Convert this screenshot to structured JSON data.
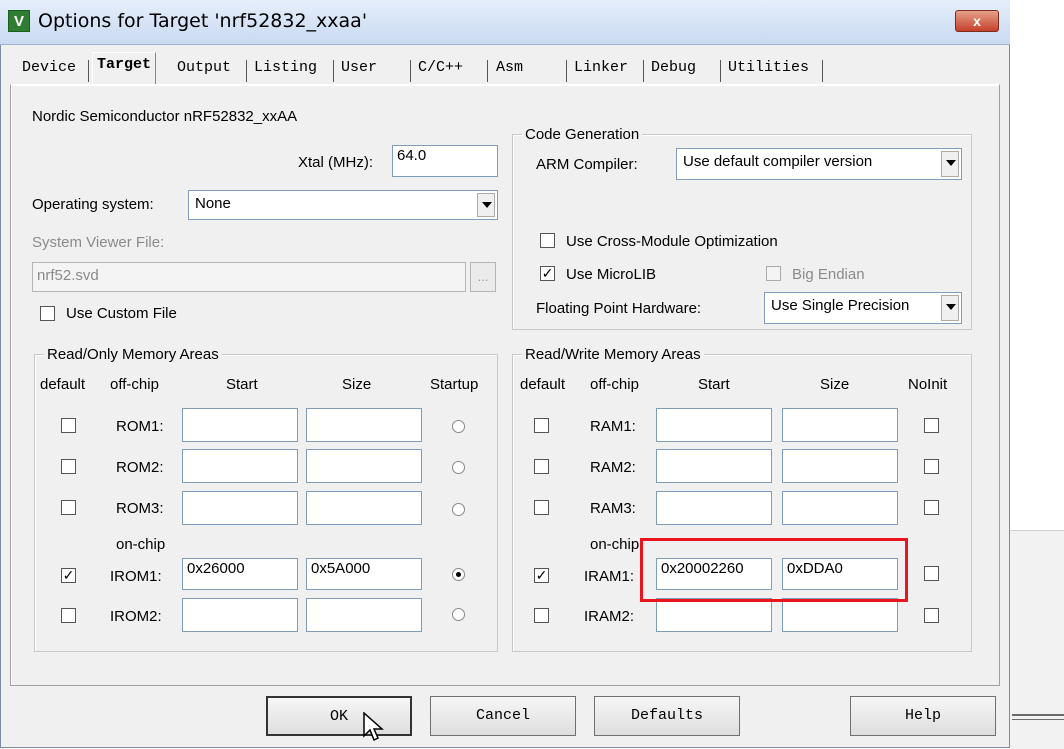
{
  "window": {
    "title": "Options for Target 'nrf52832_xxaa'",
    "icon_text": "V",
    "close_label": "x"
  },
  "tabs": [
    {
      "label": "Device",
      "selected": false
    },
    {
      "label": "Target",
      "selected": true
    },
    {
      "label": "Output",
      "selected": false
    },
    {
      "label": "Listing",
      "selected": false
    },
    {
      "label": "User",
      "selected": false
    },
    {
      "label": "C/C++",
      "selected": false
    },
    {
      "label": "Asm",
      "selected": false
    },
    {
      "label": "Linker",
      "selected": false
    },
    {
      "label": "Debug",
      "selected": false
    },
    {
      "label": "Utilities",
      "selected": false
    }
  ],
  "device": {
    "name": "Nordic Semiconductor nRF52832_xxAA"
  },
  "xtal": {
    "label": "Xtal (MHz):",
    "value": "64.0"
  },
  "os": {
    "label": "Operating system:",
    "value": "None"
  },
  "svd": {
    "label": "System Viewer File:",
    "value": "nrf52.svd",
    "browse_label": "...",
    "custom_label": "Use Custom File"
  },
  "codegen": {
    "title": "Code Generation",
    "compiler_label": "ARM Compiler:",
    "compiler_value": "Use default compiler version",
    "cross_module_label": "Use Cross-Module Optimization",
    "microlib_label": "Use MicroLIB",
    "big_endian_label": "Big Endian",
    "fph_label": "Floating Point Hardware:",
    "fph_value": "Use Single Precision"
  },
  "ro": {
    "title": "Read/Only Memory Areas",
    "headers": {
      "default": "default",
      "offchip": "off-chip",
      "start": "Start",
      "size": "Size",
      "startup": "Startup"
    },
    "onchip_label": "on-chip",
    "rows": [
      {
        "name": "ROM1:",
        "default": false,
        "start": "",
        "size": "",
        "startup": false
      },
      {
        "name": "ROM2:",
        "default": false,
        "start": "",
        "size": "",
        "startup": false
      },
      {
        "name": "ROM3:",
        "default": false,
        "start": "",
        "size": "",
        "startup": false
      },
      {
        "name": "IROM1:",
        "default": true,
        "start": "0x26000",
        "size": "0x5A000",
        "startup": true
      },
      {
        "name": "IROM2:",
        "default": false,
        "start": "",
        "size": "",
        "startup": false
      }
    ]
  },
  "rw": {
    "title": "Read/Write Memory Areas",
    "headers": {
      "default": "default",
      "offchip": "off-chip",
      "start": "Start",
      "size": "Size",
      "noinit": "NoInit"
    },
    "onchip_label": "on-chip",
    "rows": [
      {
        "name": "RAM1:",
        "default": false,
        "start": "",
        "size": "",
        "noinit": false
      },
      {
        "name": "RAM2:",
        "default": false,
        "start": "",
        "size": "",
        "noinit": false
      },
      {
        "name": "RAM3:",
        "default": false,
        "start": "",
        "size": "",
        "noinit": false
      },
      {
        "name": "IRAM1:",
        "default": true,
        "start": "0x20002260",
        "size": "0xDDA0",
        "noinit": false
      },
      {
        "name": "IRAM2:",
        "default": false,
        "start": "",
        "size": "",
        "noinit": false
      }
    ]
  },
  "buttons": {
    "ok": "OK",
    "cancel": "Cancel",
    "defaults": "Defaults",
    "help": "Help"
  },
  "colors": {
    "highlight": "#e8141e",
    "titlebar": "#c9daf2"
  }
}
